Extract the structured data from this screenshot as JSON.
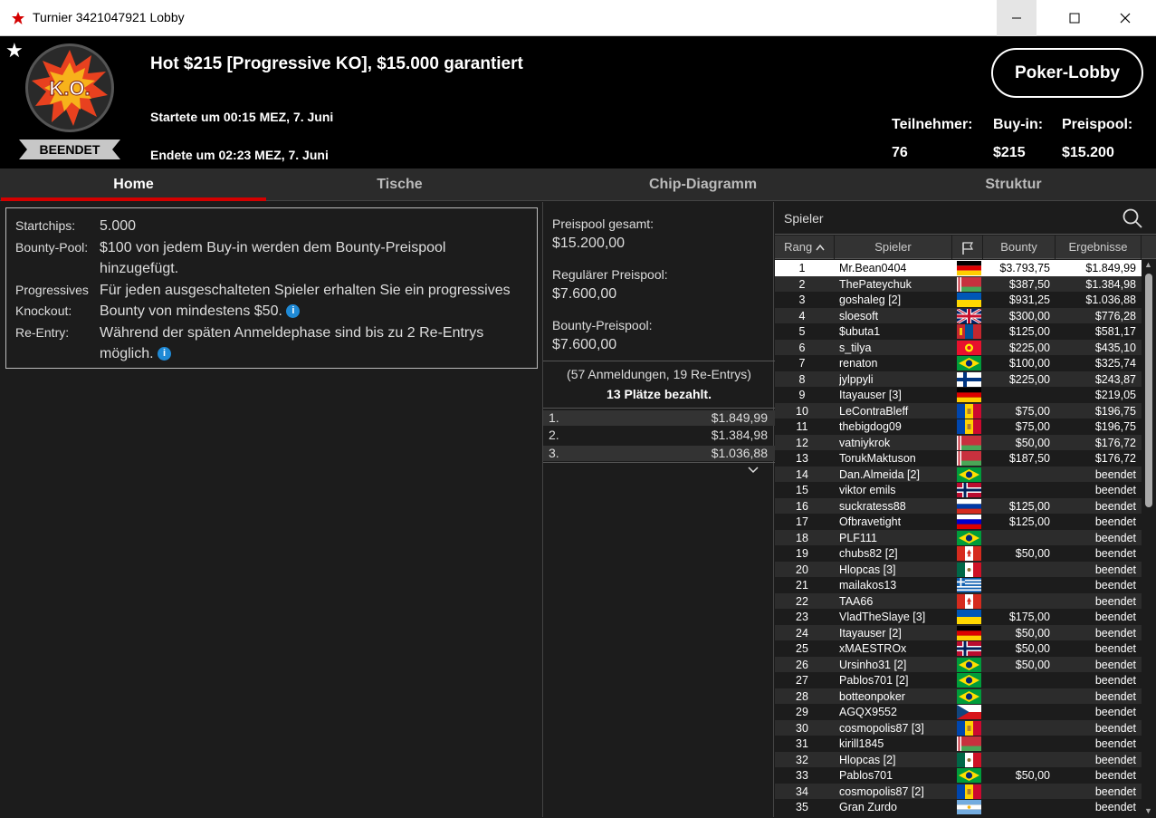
{
  "window": {
    "title": "Turnier 3421047921 Lobby"
  },
  "header": {
    "logo_text": "K.O.",
    "status": "BEENDET",
    "tournament_name": "Hot $215 [Progressive KO], $15.000 garantiert",
    "started": "Startete um 00:15 MEZ, 7. Juni",
    "ended": "Endete um 02:23 MEZ, 7. Juni",
    "lobby_button": "Poker-Lobby",
    "participants_label": "Teilnehmer:",
    "participants_value": "76",
    "buyin_label": "Buy-in:",
    "buyin_value": "$215",
    "prizepool_label": "Preispool:",
    "prizepool_value": "$15.200"
  },
  "tabs": [
    {
      "label": "Home",
      "active": true
    },
    {
      "label": "Tische"
    },
    {
      "label": "Chip-Diagramm"
    },
    {
      "label": "Struktur"
    }
  ],
  "info": {
    "startchips_label": "Startchips:",
    "startchips_value": "5.000",
    "bounty_label": "Bounty-Pool:",
    "bounty_value": "$100 von jedem Buy-in werden dem Bounty-Preispool hinzugefügt.",
    "pko_label_1": "Progressives",
    "pko_label_2": "Knockout:",
    "pko_value": "Für jeden ausgeschalteten Spieler erhalten Sie ein progressives Bounty von mindestens $50.",
    "reentry_label": "Re-Entry:",
    "reentry_value": "Während der späten Anmeldephase sind bis zu 2 Re-Entrys möglich."
  },
  "prize": {
    "total_label": "Preispool gesamt:",
    "total_value": "$15.200,00",
    "regular_label": "Regulärer Preispool:",
    "regular_value": "$7.600,00",
    "bounty_label": "Bounty-Preispool:",
    "bounty_value": "$7.600,00",
    "registrations": "(57 Anmeldungen, 19 Re-Entrys)",
    "paid_places": "13 Plätze bezahlt.",
    "payouts": [
      {
        "place": "1.",
        "amount": "$1.849,99"
      },
      {
        "place": "2.",
        "amount": "$1.384,98"
      },
      {
        "place": "3.",
        "amount": "$1.036,88"
      }
    ]
  },
  "players": {
    "search_label": "Spieler",
    "columns": {
      "rank": "Rang",
      "name": "Spieler",
      "bounty": "Bounty",
      "result": "Ergebnisse"
    },
    "rows": [
      {
        "rank": "1",
        "name": "Mr.Bean0404",
        "flag": "de",
        "bounty": "$3.793,75",
        "result": "$1.849,99"
      },
      {
        "rank": "2",
        "name": "ThePateychuk",
        "flag": "by",
        "bounty": "$387,50",
        "result": "$1.384,98"
      },
      {
        "rank": "3",
        "name": "goshaleg [2]",
        "flag": "ua",
        "bounty": "$931,25",
        "result": "$1.036,88"
      },
      {
        "rank": "4",
        "name": "sloesoft",
        "flag": "gb",
        "bounty": "$300,00",
        "result": "$776,28"
      },
      {
        "rank": "5",
        "name": "$ubuta1",
        "flag": "mn",
        "bounty": "$125,00",
        "result": "$581,17"
      },
      {
        "rank": "6",
        "name": "s_tilya",
        "flag": "kg",
        "bounty": "$225,00",
        "result": "$435,10"
      },
      {
        "rank": "7",
        "name": "renaton",
        "flag": "br",
        "bounty": "$100,00",
        "result": "$325,74"
      },
      {
        "rank": "8",
        "name": "jylppyli",
        "flag": "fi",
        "bounty": "$225,00",
        "result": "$243,87"
      },
      {
        "rank": "9",
        "name": "Itayauser [3]",
        "flag": "de",
        "bounty": "",
        "result": "$219,05"
      },
      {
        "rank": "10",
        "name": "LeContraBleff",
        "flag": "md",
        "bounty": "$75,00",
        "result": "$196,75"
      },
      {
        "rank": "11",
        "name": "thebigdog09",
        "flag": "md",
        "bounty": "$75,00",
        "result": "$196,75"
      },
      {
        "rank": "12",
        "name": "vatniykrok",
        "flag": "by",
        "bounty": "$50,00",
        "result": "$176,72"
      },
      {
        "rank": "13",
        "name": "TorukMaktuson",
        "flag": "by",
        "bounty": "$187,50",
        "result": "$176,72"
      },
      {
        "rank": "14",
        "name": "Dan.Almeida [2]",
        "flag": "br",
        "bounty": "",
        "result": "beendet"
      },
      {
        "rank": "15",
        "name": "viktor emils",
        "flag": "no",
        "bounty": "",
        "result": "beendet"
      },
      {
        "rank": "16",
        "name": "suckratess88",
        "flag": "ru",
        "bounty": "$125,00",
        "result": "beendet"
      },
      {
        "rank": "17",
        "name": "Ofbravetight",
        "flag": "si",
        "bounty": "$125,00",
        "result": "beendet"
      },
      {
        "rank": "18",
        "name": "PLF111",
        "flag": "br",
        "bounty": "",
        "result": "beendet"
      },
      {
        "rank": "19",
        "name": "chubs82 [2]",
        "flag": "ca",
        "bounty": "$50,00",
        "result": "beendet"
      },
      {
        "rank": "20",
        "name": "Hlopcas [3]",
        "flag": "mx",
        "bounty": "",
        "result": "beendet"
      },
      {
        "rank": "21",
        "name": "mailakos13",
        "flag": "gr",
        "bounty": "",
        "result": "beendet"
      },
      {
        "rank": "22",
        "name": "TAA66",
        "flag": "ca",
        "bounty": "",
        "result": "beendet"
      },
      {
        "rank": "23",
        "name": "VladTheSlaye [3]",
        "flag": "ua",
        "bounty": "$175,00",
        "result": "beendet"
      },
      {
        "rank": "24",
        "name": "Itayauser [2]",
        "flag": "de",
        "bounty": "$50,00",
        "result": "beendet"
      },
      {
        "rank": "25",
        "name": "xMAESTROx",
        "flag": "no",
        "bounty": "$50,00",
        "result": "beendet"
      },
      {
        "rank": "26",
        "name": "Ursinho31 [2]",
        "flag": "br",
        "bounty": "$50,00",
        "result": "beendet"
      },
      {
        "rank": "27",
        "name": "Pablos701 [2]",
        "flag": "br",
        "bounty": "",
        "result": "beendet"
      },
      {
        "rank": "28",
        "name": "botteonpoker",
        "flag": "br",
        "bounty": "",
        "result": "beendet"
      },
      {
        "rank": "29",
        "name": "AGQX9552",
        "flag": "cz",
        "bounty": "",
        "result": "beendet"
      },
      {
        "rank": "30",
        "name": "cosmopolis87 [3]",
        "flag": "md",
        "bounty": "",
        "result": "beendet"
      },
      {
        "rank": "31",
        "name": "kirill1845",
        "flag": "by",
        "bounty": "",
        "result": "beendet"
      },
      {
        "rank": "32",
        "name": "Hlopcas [2]",
        "flag": "mx",
        "bounty": "",
        "result": "beendet"
      },
      {
        "rank": "33",
        "name": "Pablos701",
        "flag": "br",
        "bounty": "$50,00",
        "result": "beendet"
      },
      {
        "rank": "34",
        "name": "cosmopolis87 [2]",
        "flag": "md",
        "bounty": "",
        "result": "beendet"
      },
      {
        "rank": "35",
        "name": "Gran Zurdo",
        "flag": "ar",
        "bounty": "",
        "result": "beendet"
      }
    ]
  },
  "colors": {
    "accent": "#d40000",
    "info_icon": "#1f8ad6"
  }
}
